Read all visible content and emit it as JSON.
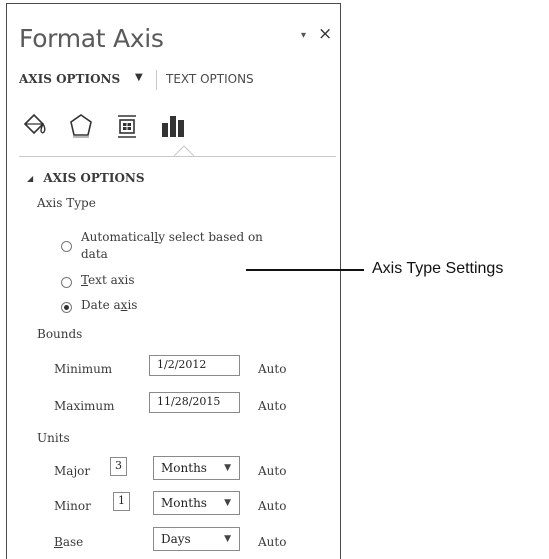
{
  "pane": {
    "title": "Format Axis",
    "pin_glyph": "▾",
    "close_glyph": "×"
  },
  "tabs": {
    "axis_options": "AXIS OPTIONS",
    "caret": "▼",
    "text_options": "TEXT OPTIONS"
  },
  "icons": [
    "fill-line-icon",
    "effects-icon",
    "size-properties-icon",
    "axis-options-icon"
  ],
  "section": {
    "collapse_glyph": "◢",
    "title": "AXIS OPTIONS"
  },
  "axis_type": {
    "label": "Axis Type",
    "options": [
      {
        "pre": "Automatical",
        "ul": "l",
        "post": "y select based on",
        "line2": "data",
        "selected": false
      },
      {
        "pre": "",
        "ul": "T",
        "post": "ext axis",
        "selected": false
      },
      {
        "pre": "Date a",
        "ul": "x",
        "post": "is",
        "selected": true
      }
    ]
  },
  "bounds": {
    "label": "Bounds",
    "minimum_label": "Minimum",
    "minimum_value": "1/2/2012",
    "minimum_auto": "Auto",
    "maximum_label": "Maximum",
    "maximum_value": "11/28/2015",
    "maximum_auto": "Auto"
  },
  "units": {
    "label": "Units",
    "major_label": "Major",
    "major_value": "3",
    "major_unit": "Months",
    "major_auto": "Auto",
    "minor_label": "Minor",
    "minor_value": "1",
    "minor_unit": "Months",
    "minor_auto": "Auto",
    "base_label_ul": "B",
    "base_label_rest": "ase",
    "base_unit": "Days",
    "base_auto": "Auto",
    "dropdown_arrow": "▼"
  },
  "callout": {
    "text": "Axis Type Settings"
  },
  "colors": {
    "border": "#4a4a4a",
    "text": "#3a3a3a",
    "accent": "#111111"
  }
}
